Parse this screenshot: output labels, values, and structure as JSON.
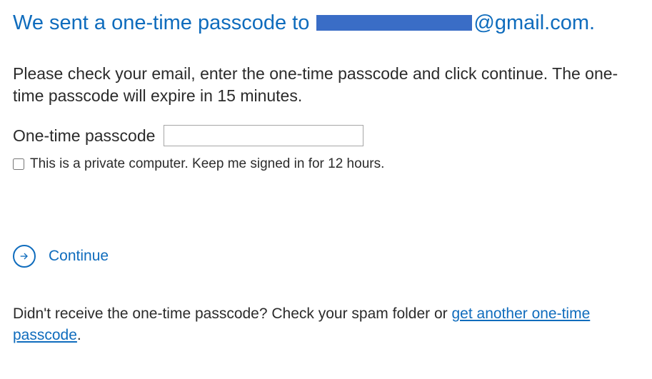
{
  "heading": {
    "prefix": "We sent a one-time passcode to ",
    "emailDomain": "@gmail.com."
  },
  "instructions": "Please check your email, enter the one-time passcode and click continue. The one-time passcode will expire in 15 minutes.",
  "passcode": {
    "label": "One-time passcode",
    "value": ""
  },
  "privateCheckbox": {
    "label": "This is a private computer. Keep me signed in for 12 hours.",
    "checked": false
  },
  "continue": {
    "label": "Continue"
  },
  "footer": {
    "prefix": "Didn't receive the one-time passcode? Check your spam folder or ",
    "linkText": "get another one-time passcode",
    "suffix": "."
  }
}
